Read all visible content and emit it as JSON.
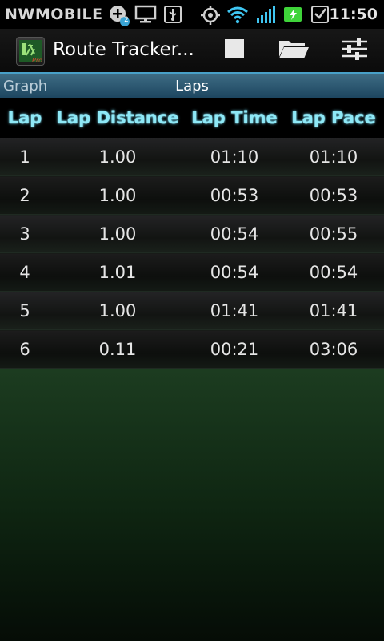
{
  "status_bar": {
    "carrier": "NWMOBILE",
    "notification_count": "2",
    "clock": "11:50",
    "icons": [
      "add-notification-icon",
      "monitor-icon",
      "usb-icon",
      "gps-icon",
      "wifi-icon",
      "signal-icon",
      "battery-charging-icon",
      "checkbox-icon"
    ]
  },
  "action_bar": {
    "title": "Route Tracker...",
    "app_icon_label": "Pro",
    "actions": [
      "stop-icon",
      "folder-open-icon",
      "settings-sliders-icon"
    ]
  },
  "tabs": {
    "left": "Graph",
    "current": "Laps"
  },
  "laps_table": {
    "headers": [
      "Lap",
      "Lap Distance",
      "Lap Time",
      "Lap Pace"
    ],
    "rows": [
      [
        "1",
        "1.00",
        "01:10",
        "01:10"
      ],
      [
        "2",
        "1.00",
        "00:53",
        "00:53"
      ],
      [
        "3",
        "1.00",
        "00:54",
        "00:55"
      ],
      [
        "4",
        "1.01",
        "00:54",
        "00:54"
      ],
      [
        "5",
        "1.00",
        "01:41",
        "01:41"
      ],
      [
        "6",
        "0.11",
        "00:21",
        "03:06"
      ]
    ]
  },
  "colors": {
    "header_text": "#8ee8f6",
    "tab_accent": "#48a0c8",
    "battery": "#3fd43a"
  }
}
